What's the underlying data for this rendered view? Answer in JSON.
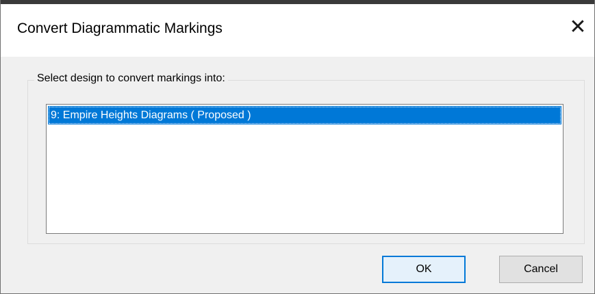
{
  "dialog": {
    "title": "Convert Diagrammatic Markings",
    "close_glyph": "✕",
    "close_icon": "close-icon"
  },
  "group": {
    "label": "Select design to convert markings into:"
  },
  "list": {
    "items": [
      {
        "label": "9: Empire Heights Diagrams ( Proposed )",
        "selected": true
      }
    ]
  },
  "buttons": {
    "ok_label": "OK",
    "cancel_label": "Cancel"
  },
  "colors": {
    "selection": "#0078d7",
    "default_button_border": "#0078d7",
    "dialog_background": "#f0f0f0"
  }
}
